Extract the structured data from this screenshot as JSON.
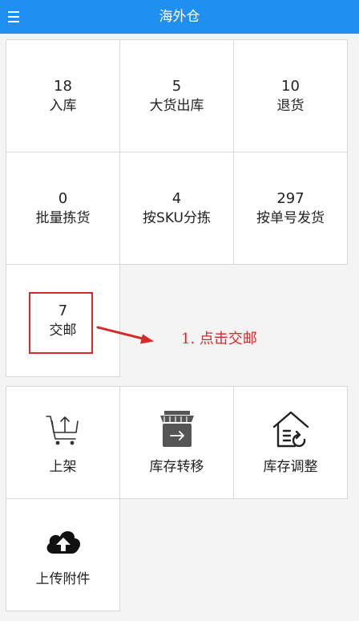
{
  "header": {
    "title": "海外仓",
    "menu_icon": "hamburger-menu-icon",
    "background_color": "#1f8ff2"
  },
  "tasks": [
    {
      "count": "18",
      "label": "入库"
    },
    {
      "count": "5",
      "label": "大货出库"
    },
    {
      "count": "10",
      "label": "退货"
    },
    {
      "count": "0",
      "label": "批量拣货"
    },
    {
      "count": "4",
      "label": "按SKU分拣"
    },
    {
      "count": "297",
      "label": "按单号发货"
    },
    {
      "count": "7",
      "label": "交邮"
    }
  ],
  "tools": [
    {
      "label": "上架",
      "icon": "cart-upload-icon"
    },
    {
      "label": "库存转移",
      "icon": "store-transfer-icon"
    },
    {
      "label": "库存调整",
      "icon": "house-refresh-icon"
    },
    {
      "label": "上传附件",
      "icon": "cloud-upload-icon"
    }
  ],
  "annotation": {
    "text": "1. 点击交邮",
    "color": "#d52a2a"
  }
}
